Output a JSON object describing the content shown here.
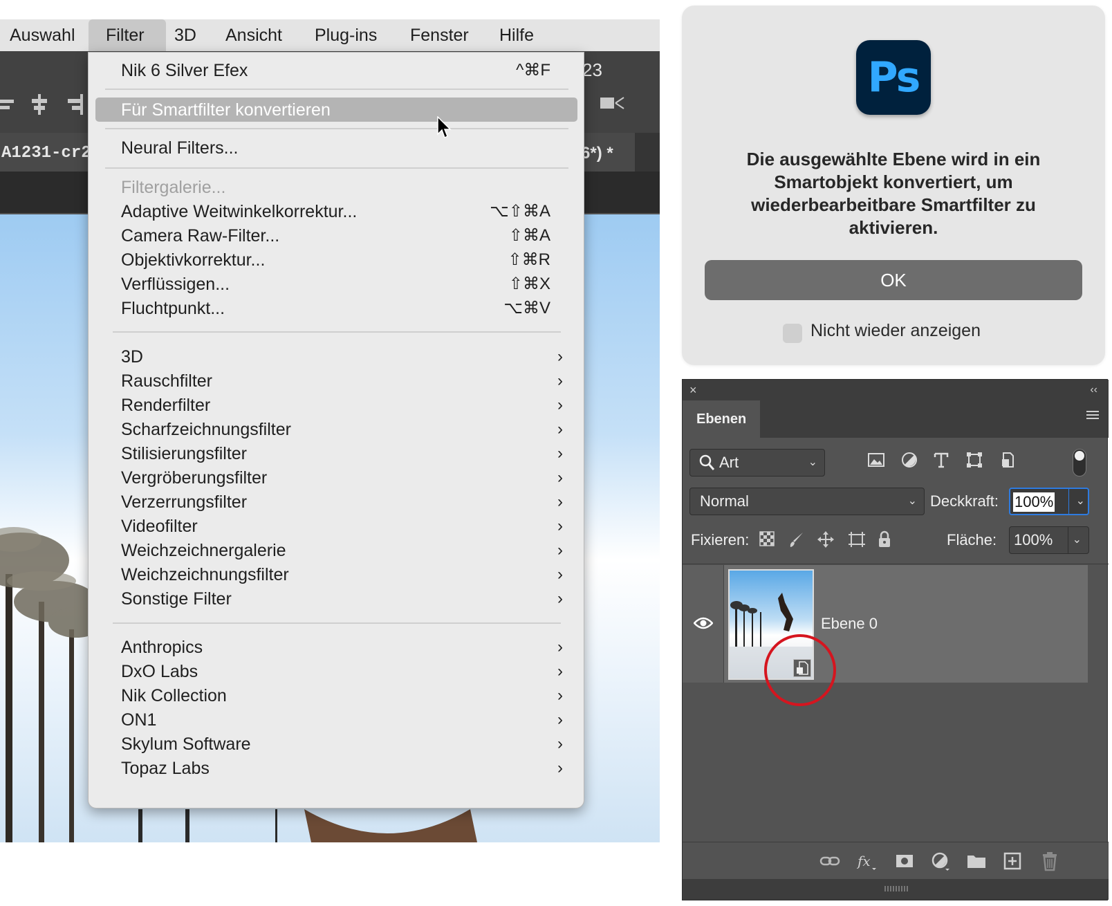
{
  "menubar": {
    "items": [
      "Auswahl",
      "Filter",
      "3D",
      "Ansicht",
      "Plug-ins",
      "Fenster",
      "Hilfe"
    ],
    "active": "Filter"
  },
  "background_window": {
    "title_fragment": "23",
    "tab_left": "A1231-cr2_",
    "tab_right": "6*) *"
  },
  "filter_menu": {
    "items": [
      {
        "label": "Nik 6 Silver Efex",
        "shortcut": "^⌘F"
      },
      {
        "label": "Für Smartfilter konvertieren",
        "highlighted": true
      },
      {
        "label": "Neural Filters..."
      },
      {
        "label": "Filtergalerie...",
        "disabled": true
      },
      {
        "label": "Adaptive Weitwinkelkorrektur...",
        "shortcut": "⌥⇧⌘A"
      },
      {
        "label": "Camera Raw-Filter...",
        "shortcut": "⇧⌘A"
      },
      {
        "label": "Objektivkorrektur...",
        "shortcut": "⇧⌘R"
      },
      {
        "label": "Verflüssigen...",
        "shortcut": "⇧⌘X"
      },
      {
        "label": "Fluchtpunkt...",
        "shortcut": "⌥⌘V"
      },
      {
        "label": "3D",
        "submenu": true
      },
      {
        "label": "Rauschfilter",
        "submenu": true
      },
      {
        "label": "Renderfilter",
        "submenu": true
      },
      {
        "label": "Scharfzeichnungsfilter",
        "submenu": true
      },
      {
        "label": "Stilisierungsfilter",
        "submenu": true
      },
      {
        "label": "Vergröberungsfilter",
        "submenu": true
      },
      {
        "label": "Verzerrungsfilter",
        "submenu": true
      },
      {
        "label": "Videofilter",
        "submenu": true
      },
      {
        "label": "Weichzeichnergalerie",
        "submenu": true
      },
      {
        "label": "Weichzeichnungsfilter",
        "submenu": true
      },
      {
        "label": "Sonstige Filter",
        "submenu": true
      },
      {
        "label": "Anthropics",
        "submenu": true
      },
      {
        "label": "DxO Labs",
        "submenu": true
      },
      {
        "label": "Nik Collection",
        "submenu": true
      },
      {
        "label": "ON1",
        "submenu": true
      },
      {
        "label": "Skylum Software",
        "submenu": true
      },
      {
        "label": "Topaz Labs",
        "submenu": true
      }
    ],
    "submenu_arrow": "›"
  },
  "dialog": {
    "logo_text": "Ps",
    "message": "Die ausgewählte Ebene wird in ein Smartobjekt konvertiert, um wiederbearbeitbare Smartfilter zu aktivieren.",
    "ok_label": "OK",
    "checkbox_label": "Nicht wieder anzeigen",
    "checkbox_checked": false
  },
  "layers_panel": {
    "close_glyph": "×",
    "collapse_glyph": "‹‹",
    "tab_label": "Ebenen",
    "filter_kind": "Art",
    "blend_mode": "Normal",
    "opacity_label": "Deckkraft:",
    "opacity_value": "100%",
    "lock_label": "Fixieren:",
    "fill_label": "Fläche:",
    "fill_value": "100%",
    "layers": [
      {
        "name": "Ebene 0",
        "visible": true,
        "smart_object": true
      }
    ],
    "filter_icons": [
      "image-filter-icon",
      "adjustment-filter-icon",
      "type-filter-icon",
      "shape-filter-icon",
      "smart-object-filter-icon"
    ],
    "lock_icons": [
      "lock-transparent-pixels-icon",
      "lock-image-pixels-icon",
      "lock-position-icon",
      "lock-artboard-icon",
      "lock-all-icon"
    ],
    "bottom_icons": [
      "link-layers-icon",
      "fx-icon",
      "add-mask-icon",
      "adjustment-layer-icon",
      "group-folder-icon",
      "new-layer-icon",
      "trash-icon"
    ]
  },
  "colors": {
    "annotation_circle": "#d5151f",
    "ps_logo_bg": "#00213d",
    "ps_logo_text": "#31a8ff",
    "opacity_focus": "#2e7be0"
  }
}
